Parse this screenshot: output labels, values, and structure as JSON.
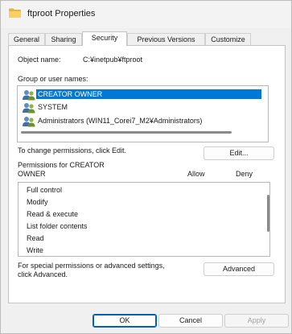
{
  "window": {
    "title": "ftproot Properties"
  },
  "tabs": [
    {
      "label": "General",
      "active": false
    },
    {
      "label": "Sharing",
      "active": false
    },
    {
      "label": "Security",
      "active": true
    },
    {
      "label": "Previous Versions",
      "active": false
    },
    {
      "label": "Customize",
      "active": false
    }
  ],
  "security": {
    "object_name_label": "Object name:",
    "object_name_value": "C:¥inetpub¥ftproot",
    "group_label": "Group or user names:",
    "users": [
      {
        "name": "CREATOR OWNER",
        "selected": true,
        "icon": "users-group-icon"
      },
      {
        "name": "SYSTEM",
        "selected": false,
        "icon": "users-group-icon"
      },
      {
        "name": "Administrators (WIN11_Corei7_M2¥Administrators)",
        "selected": false,
        "icon": "users-group-icon"
      }
    ],
    "change_hint": "To change permissions, click Edit.",
    "edit_button": "Edit...",
    "permissions_for_line1": "Permissions for CREATOR",
    "permissions_for_line2": "OWNER",
    "allow_header": "Allow",
    "deny_header": "Deny",
    "permissions": [
      {
        "name": "Full control"
      },
      {
        "name": "Modify"
      },
      {
        "name": "Read & execute"
      },
      {
        "name": "List folder contents"
      },
      {
        "name": "Read"
      },
      {
        "name": "Write"
      }
    ],
    "special_hint_line1": "For special permissions or advanced settings,",
    "special_hint_line2": "click Advanced.",
    "advanced_button": "Advanced"
  },
  "footer": {
    "ok": "OK",
    "cancel": "Cancel",
    "apply": "Apply"
  },
  "colors": {
    "selection": "#0078d7",
    "folder": "#f2c14e",
    "accent_border": "#005fb8"
  }
}
